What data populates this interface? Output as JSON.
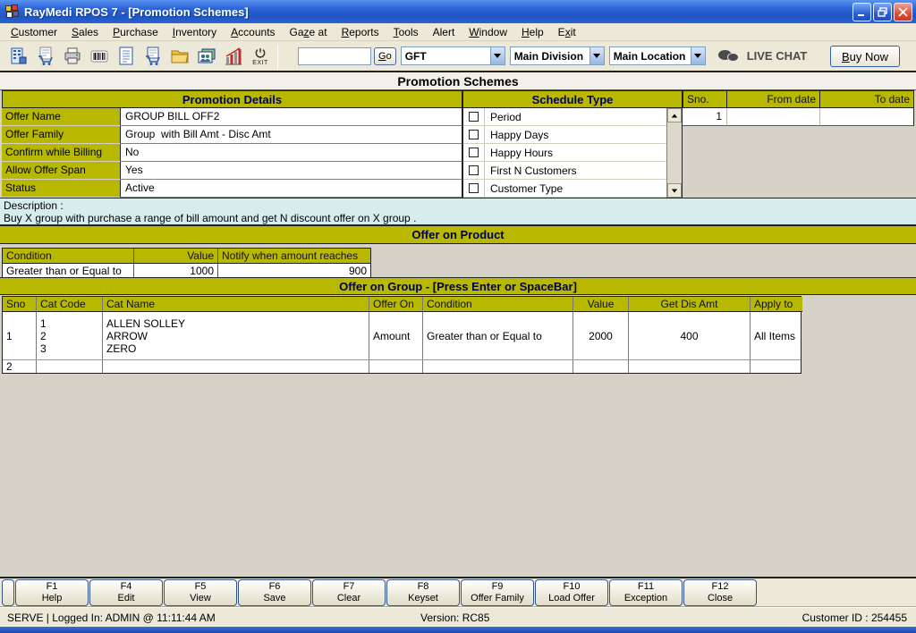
{
  "window": {
    "title": "RayMedi RPOS 7 - [Promotion Schemes]"
  },
  "menu_bar": [
    {
      "label": "Customer",
      "accel": 0
    },
    {
      "label": "Sales",
      "accel": 0
    },
    {
      "label": "Purchase",
      "accel": 0
    },
    {
      "label": "Inventory",
      "accel": 0
    },
    {
      "label": "Accounts",
      "accel": 0
    },
    {
      "label": "Gaze at",
      "accel": 2
    },
    {
      "label": "Reports",
      "accel": 0
    },
    {
      "label": "Tools",
      "accel": 0
    },
    {
      "label": "Alert",
      "accel": -1
    },
    {
      "label": "Window",
      "accel": 0
    },
    {
      "label": "Help",
      "accel": 0
    },
    {
      "label": "Exit",
      "accel": 1
    }
  ],
  "toolbar": {
    "icons": [
      {
        "name": "bill-machine-icon"
      },
      {
        "name": "sales-cart-icon"
      },
      {
        "name": "printer-icon"
      },
      {
        "name": "barcode-icon"
      },
      {
        "name": "report-icon"
      },
      {
        "name": "purchase-cart-icon"
      },
      {
        "name": "folder-icon"
      },
      {
        "name": "customers-icon"
      },
      {
        "name": "sales-chart-icon"
      },
      {
        "name": "exit-icon",
        "label": "EXIT"
      }
    ],
    "search_value": "",
    "go_label": "Go",
    "go_accel": 0,
    "company_select": "GFT",
    "division_select": "Main Division",
    "location_select": "Main Location",
    "live_chat_label": "LIVE CHAT",
    "buy_now_label": "Buy Now",
    "buy_now_accel": 0
  },
  "page_title": "Promotion Schemes",
  "promotion_details": {
    "header": "Promotion Details",
    "fields": [
      {
        "label": "Offer Name",
        "value": "GROUP BILL OFF2"
      },
      {
        "label": "Offer Family",
        "value": "Group  with Bill Amt - Disc Amt"
      },
      {
        "label": "Confirm while Billing",
        "value": "No"
      },
      {
        "label": "Allow Offer Span",
        "value": "Yes"
      },
      {
        "label": "Status",
        "value": "Active"
      }
    ]
  },
  "schedule_type": {
    "header": "Schedule Type",
    "options": [
      {
        "label": "Period",
        "checked": false
      },
      {
        "label": "Happy Days",
        "checked": false
      },
      {
        "label": "Happy Hours",
        "checked": false
      },
      {
        "label": "First N Customers",
        "checked": false
      },
      {
        "label": "Customer Type",
        "checked": false
      }
    ]
  },
  "schedule_table": {
    "columns": [
      "Sno.",
      "From date",
      "To date"
    ],
    "rows": [
      {
        "sno": "1",
        "from_date": "",
        "to_date": ""
      }
    ]
  },
  "description": {
    "label": "Description :",
    "text": "Buy X group with purchase a range of bill amount and get N discount offer on X group ."
  },
  "offer_on_product": {
    "header": "Offer on Product",
    "columns": [
      "Condition",
      "Value",
      "Notify when amount reaches"
    ],
    "rows": [
      [
        "Greater than or Equal to",
        "1000",
        "900"
      ]
    ]
  },
  "offer_on_group": {
    "header": "Offer on Group - [Press Enter or SpaceBar]",
    "columns": [
      "Sno",
      "Cat Code",
      "Cat Name",
      "Offer On",
      "Condition",
      "Value",
      "Get Dis Amt",
      "Apply to"
    ],
    "rows": [
      {
        "sno": "1",
        "cat_code": [
          "1",
          "2",
          "3"
        ],
        "cat_name": [
          "ALLEN SOLLEY",
          "ARROW",
          "ZERO"
        ],
        "offer_on": "Amount",
        "condition": "Greater than or Equal to",
        "value": "2000",
        "get_dis_amt": "400",
        "apply_to": "All Items"
      },
      {
        "sno": "2",
        "cat_code": [],
        "cat_name": [],
        "offer_on": "",
        "condition": "",
        "value": "",
        "get_dis_amt": "",
        "apply_to": ""
      }
    ]
  },
  "function_keys": [
    {
      "key": "F1",
      "label": "Help"
    },
    {
      "key": "F4",
      "label": "Edit"
    },
    {
      "key": "F5",
      "label": "View"
    },
    {
      "key": "F6",
      "label": "Save"
    },
    {
      "key": "F7",
      "label": "Clear"
    },
    {
      "key": "F8",
      "label": "Keyset"
    },
    {
      "key": "F9",
      "label": "Offer Family"
    },
    {
      "key": "F10",
      "label": "Load Offer"
    },
    {
      "key": "F11",
      "label": "Exception"
    },
    {
      "key": "F12",
      "label": "Close"
    }
  ],
  "status_bar": {
    "left": "SERVE |  Logged In: ADMIN  @ 11:11:44 AM",
    "center": "Version: RC85",
    "right": "Customer ID : 254455"
  },
  "colors": {
    "accent_olive": "#b8b800",
    "section_header_text": "#000066",
    "titlebar_blue": "#2a5fd0",
    "description_bg": "#d7eded",
    "content_gray": "#d6d2c8",
    "live_chat_gray": "#4a4a4a"
  }
}
